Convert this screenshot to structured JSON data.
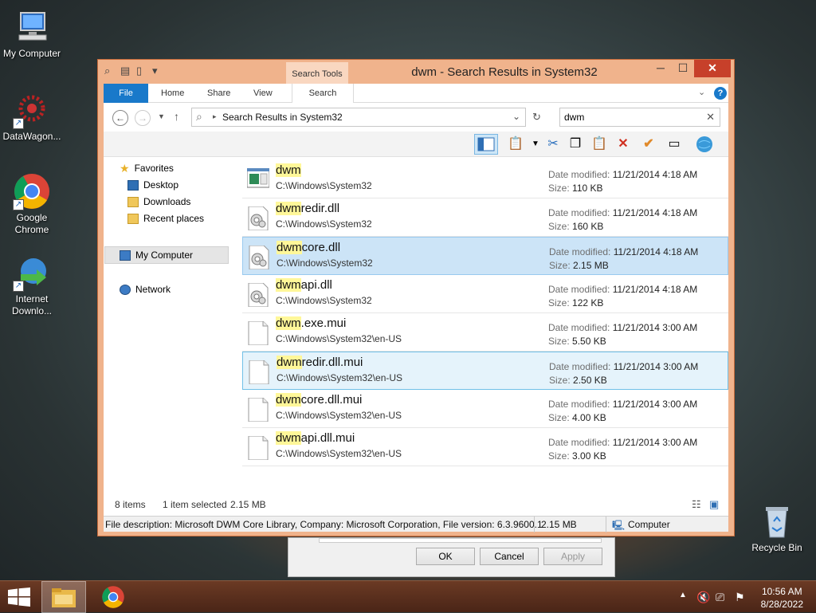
{
  "desktop": {
    "icons": [
      {
        "label": "My Computer"
      },
      {
        "label": "DataWagon..."
      },
      {
        "label": "Google Chrome"
      },
      {
        "label": "Internet Downlo..."
      },
      {
        "label": "Recycle Bin"
      }
    ]
  },
  "behind_dialog": {
    "ok": "OK",
    "cancel": "Cancel",
    "apply": "Apply"
  },
  "window": {
    "title": "dwm - Search Results in System32",
    "context_tab": "Search Tools",
    "ribbon_tabs": [
      "File",
      "Home",
      "Share",
      "View",
      "Search"
    ],
    "address": "Search Results in System32",
    "search_value": "dwm",
    "help": "?",
    "minimize": "─",
    "maximize": "☐",
    "close": "✕"
  },
  "navpane": {
    "favorites": "Favorites",
    "desktop": "Desktop",
    "downloads": "Downloads",
    "recent": "Recent places",
    "my_computer": "My Computer",
    "network": "Network"
  },
  "files": [
    {
      "highlight": "dwm",
      "rest": "",
      "path": "C:\\Windows\\System32",
      "date_label": "Date modified:",
      "date": "11/21/2014 4:18 AM",
      "size_label": "Size:",
      "size": "110 KB",
      "icon": "exe-icon"
    },
    {
      "highlight": "dwm",
      "rest": "redir.dll",
      "path": "C:\\Windows\\System32",
      "date_label": "Date modified:",
      "date": "11/21/2014 4:18 AM",
      "size_label": "Size:",
      "size": "160 KB",
      "icon": "dll-icon"
    },
    {
      "highlight": "dwm",
      "rest": "core.dll",
      "path": "C:\\Windows\\System32",
      "date_label": "Date modified:",
      "date": "11/21/2014 4:18 AM",
      "size_label": "Size:",
      "size": "2.15 MB",
      "icon": "dll-icon",
      "state": "selected"
    },
    {
      "highlight": "dwm",
      "rest": "api.dll",
      "path": "C:\\Windows\\System32",
      "date_label": "Date modified:",
      "date": "11/21/2014 4:18 AM",
      "size_label": "Size:",
      "size": "122 KB",
      "icon": "dll-icon"
    },
    {
      "highlight": "dwm",
      "rest": ".exe.mui",
      "path": "C:\\Windows\\System32\\en-US",
      "date_label": "Date modified:",
      "date": "11/21/2014 3:00 AM",
      "size_label": "Size:",
      "size": "5.50 KB",
      "icon": "file-icon"
    },
    {
      "highlight": "dwm",
      "rest": "redir.dll.mui",
      "path": "C:\\Windows\\System32\\en-US",
      "date_label": "Date modified:",
      "date": "11/21/2014 3:00 AM",
      "size_label": "Size:",
      "size": "2.50 KB",
      "icon": "file-icon",
      "state": "hover"
    },
    {
      "highlight": "dwm",
      "rest": "core.dll.mui",
      "path": "C:\\Windows\\System32\\en-US",
      "date_label": "Date modified:",
      "date": "11/21/2014 3:00 AM",
      "size_label": "Size:",
      "size": "4.00 KB",
      "icon": "file-icon"
    },
    {
      "highlight": "dwm",
      "rest": "api.dll.mui",
      "path": "C:\\Windows\\System32\\en-US",
      "date_label": "Date modified:",
      "date": "11/21/2014 3:00 AM",
      "size_label": "Size:",
      "size": "3.00 KB",
      "icon": "file-icon"
    }
  ],
  "status": {
    "items": "8 items",
    "selected": "1 item selected",
    "selected_size": "2.15 MB"
  },
  "details": {
    "description": "File description: Microsoft DWM Core Library, Company: Microsoft Corporation, File version: 6.3.9600.1",
    "size": "2.15 MB",
    "location": "Computer"
  },
  "taskbar": {
    "time": "10:56 AM",
    "date": "8/28/2022"
  }
}
